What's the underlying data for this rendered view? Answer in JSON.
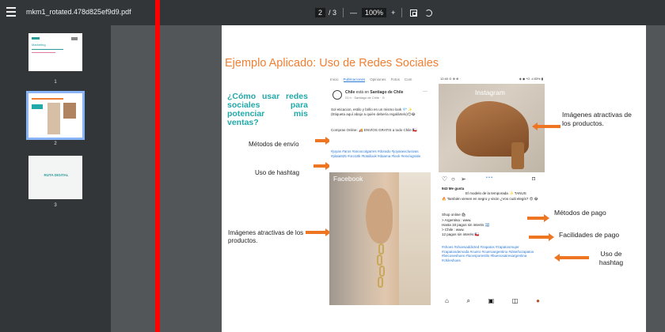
{
  "toolbar": {
    "title": "mkm1_rotated.478d825ef9d9.pdf",
    "page_current": "2",
    "page_total": "/ 3",
    "zoom_out": "—",
    "zoom": "100%",
    "zoom_in": "+"
  },
  "sidebar": {
    "thumbs": [
      {
        "num": "1",
        "title": "Marketing"
      },
      {
        "num": "2"
      },
      {
        "num": "3",
        "logo": "RUTA DIGITAL"
      }
    ]
  },
  "slide": {
    "title": "Ejemplo Aplicado: Uso de Redes Sociales",
    "question": "¿Cómo usar redes sociales para potenciar mis ventas?",
    "labels": {
      "shipping": "Métodos de envío",
      "hashtag_left": "Uso de hashtag",
      "images_left": "Imágenes atractivas de los productos.",
      "images_right": "Imágenes atractivas de los productos.",
      "payment": "Métodos de pago",
      "payment_ease": "Facilidades de pago",
      "hashtag_right": "Uso de hashtag"
    },
    "facebook": {
      "tabs": [
        "Inicio",
        "Publicaciones",
        "Opiniones",
        "Fotos",
        "Com"
      ],
      "name_prefix": "está en",
      "name": "Santiago de Chile",
      "page": "Chile",
      "meta": "21 h · Santiago de Chile · ⊙",
      "text1": "Sol eticacion, estilo y brillo en un mismo look 💎 ✨ (Etiqueta aquí abajo a quién debería regalártelo)😊😂",
      "text2": "Compras Online: 🚚 ENVÍOS GRATIS a todo Chile 🇨🇱",
      "tags": "#joyas #aros #anoocolgarres #dorado #joyasexclusivas #plata925 #oro18k #totallook #daama #look #envíogratis",
      "photo_label": "Facebook"
    },
    "instagram": {
      "status_left": "12:40 ⊙ ⊕ ⊕ ·",
      "status_right": "◈ ◉ ⁴G .ıl 83% ▮",
      "photo_label": "Instagram",
      "likes": "943 Me gusta",
      "caption": "El modelo de la temporada ✨ TANUS",
      "line2": "🔥 También vienen en negro y visón ¿Vos cuál elegís? 😍 😂",
      "shop": "Shop online 🛍",
      "ar": "> Argentina : www.",
      "ar_pay": "Hasta 18 pagos sin interés 🇦🇷",
      "cl": "> Chile : www.",
      "cl_pay": "12 pagos sin interés 🇨🇱",
      "tags": "#shoes #shoesaddicted #zapatos #zapatosmujer #zapatosdemoda #cuero #cueroargentino #diseñozapatos #becoseshoes #lucesporestilo #buenosairesargentina #chileshoes"
    }
  },
  "colors": {
    "toolbar_bg": "#323639",
    "viewer_bg": "#525659",
    "title_orange": "#f07f32",
    "question_teal": "#22a9a9",
    "arrow_orange": "#ee7522",
    "red_marker": "#ff0000"
  }
}
